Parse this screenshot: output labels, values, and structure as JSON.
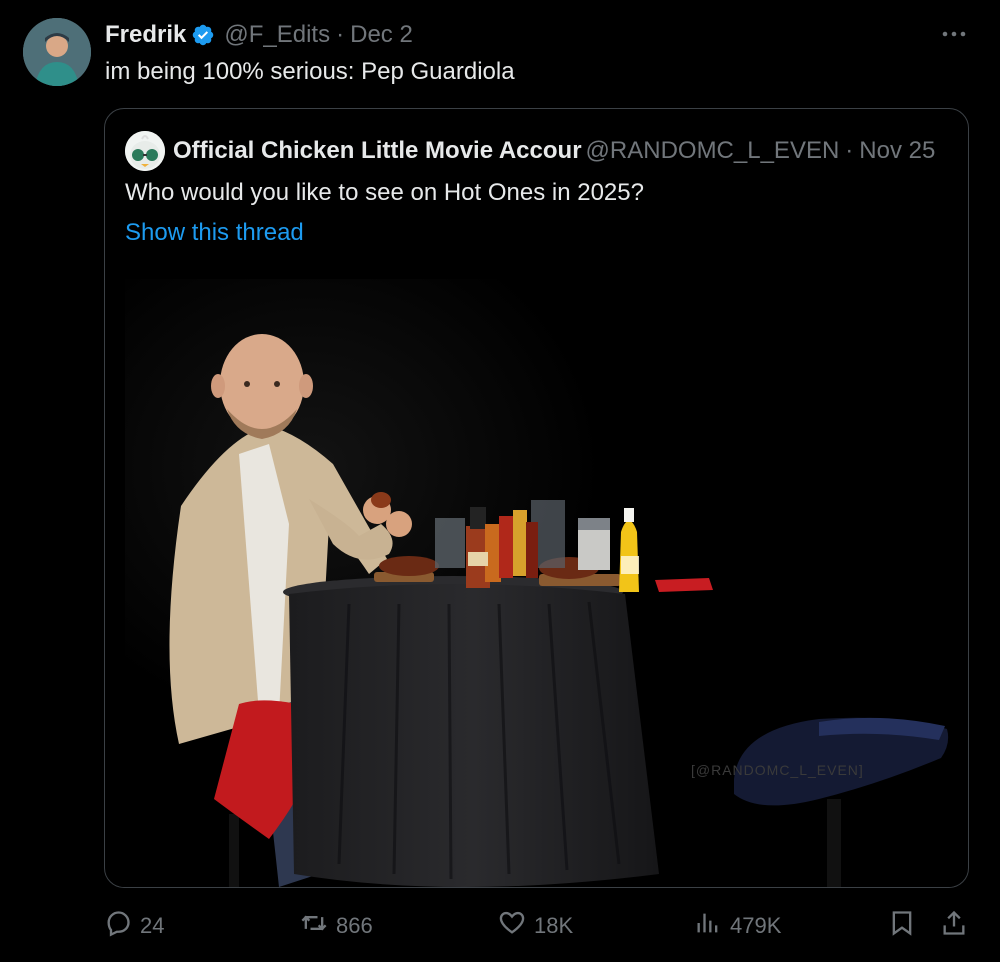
{
  "tweet": {
    "author_name": "Fredrik",
    "author_handle": "@F_Edits",
    "separator": "·",
    "date": "Dec 2",
    "text": "im being 100% serious: Pep Guardiola",
    "verified": true,
    "avatar_icon": "person-avatar"
  },
  "quote": {
    "author_name": "Official Chicken Little Movie Accour",
    "author_handle": "@RANDOMC_L_EVEN",
    "separator": "·",
    "date": "Nov 25",
    "text": "Who would you like to see on Hot Ones in 2025?",
    "thread_link": "Show this thread",
    "avatar_icon": "chicken-little-avatar",
    "media_watermark": "[@RANDOMC_L_EVEN]"
  },
  "actions": {
    "replies": "24",
    "reposts": "866",
    "likes": "18K",
    "views": "479K"
  },
  "colors": {
    "background": "#000000",
    "text": "#e7e9ea",
    "muted": "#71767b",
    "link": "#1d9bf0",
    "verified": "#1d9bf0",
    "border": "#3b4045"
  }
}
